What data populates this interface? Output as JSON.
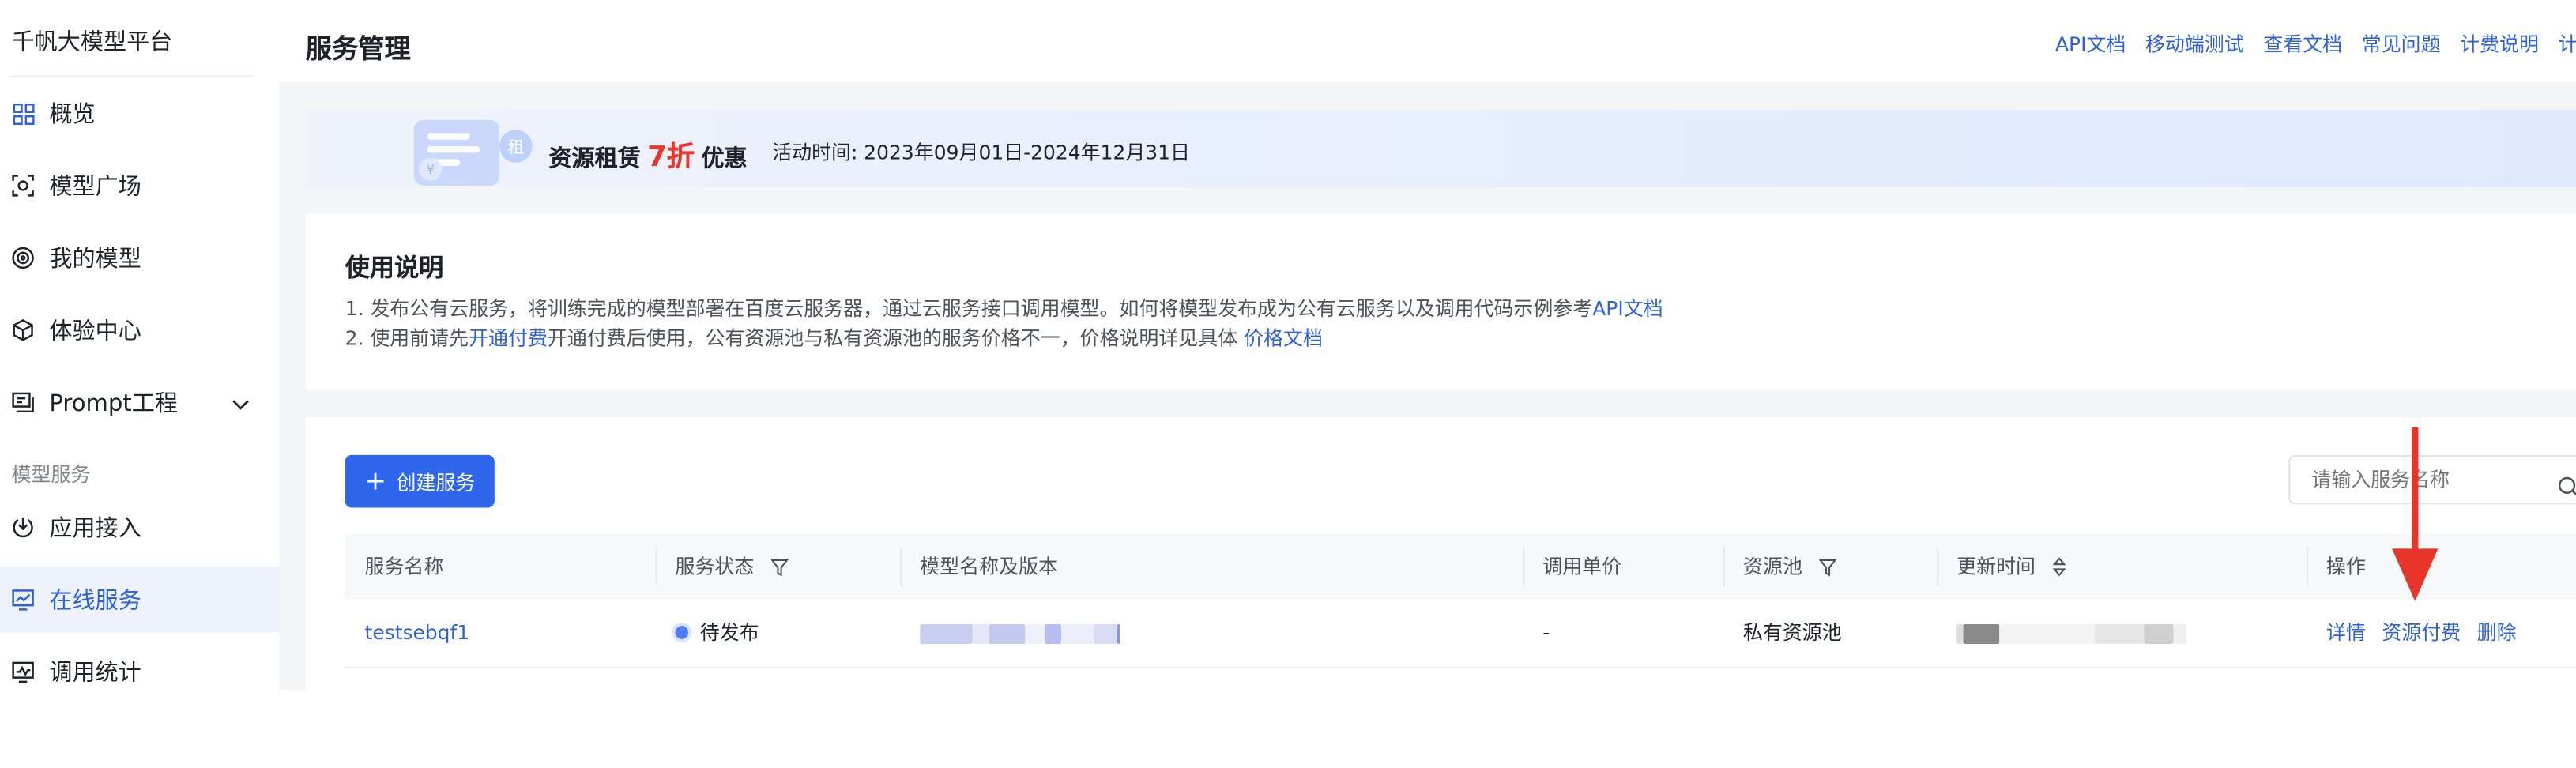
{
  "sidebar": {
    "logo": "千帆大模型平台",
    "items": [
      {
        "label": "概览",
        "icon": "grid-icon"
      },
      {
        "label": "模型广场",
        "icon": "model-plaza-icon"
      },
      {
        "label": "我的模型",
        "icon": "my-model-icon"
      },
      {
        "label": "体验中心",
        "icon": "cube-icon"
      },
      {
        "label": "Prompt工程",
        "icon": "prompt-icon"
      }
    ],
    "group_label": "模型服务",
    "service_items": [
      {
        "label": "应用接入",
        "icon": "app-access-icon"
      },
      {
        "label": "在线服务",
        "icon": "online-service-icon",
        "active": true
      },
      {
        "label": "调用统计",
        "icon": "stats-icon"
      }
    ],
    "collapse_glyph": "◂"
  },
  "header": {
    "title": "服务管理",
    "links": [
      "API文档",
      "移动端测试",
      "查看文档",
      "常见问题",
      "计费说明",
      "计费管理"
    ]
  },
  "banner": {
    "prefix": "资源租赁",
    "discount": "7折",
    "suffix": "优惠",
    "period": "活动时间: 2023年09月01日-2024年12月31日",
    "art_glyph_1": "租",
    "art_glyph_2": "¥"
  },
  "usage": {
    "title": "使用说明",
    "line1_text": "1. 发布公有云服务，将训练完成的模型部署在百度云服务器，通过云服务接口调用模型。如何将模型发布成为公有云服务以及调用代码示例参考",
    "line1_link": "API文档",
    "line2_prefix": "2. 使用前请先",
    "line2_link": "开通付费",
    "line2_middle": "开通付费后使用，公有资源池与私有资源池的服务价格不一，价格说明详见具体 ",
    "line2_link2": "价格文档"
  },
  "toolbar": {
    "create_label": "创建服务",
    "create_glyph": "+",
    "search_placeholder": "请输入服务名称"
  },
  "table": {
    "columns": [
      "服务名称",
      "服务状态",
      "模型名称及版本",
      "调用单价",
      "资源池",
      "更新时间",
      "操作"
    ],
    "rows": [
      {
        "name": "testsebqf1",
        "status": "待发布",
        "price": "-",
        "pool": "私有资源池",
        "actions": [
          "详情",
          "资源付费",
          "删除"
        ]
      }
    ]
  },
  "colors": {
    "primary": "#2e66ec",
    "link": "#2f61d5",
    "discount": "#e8362b",
    "annotation_arrow": "#e8352b"
  }
}
